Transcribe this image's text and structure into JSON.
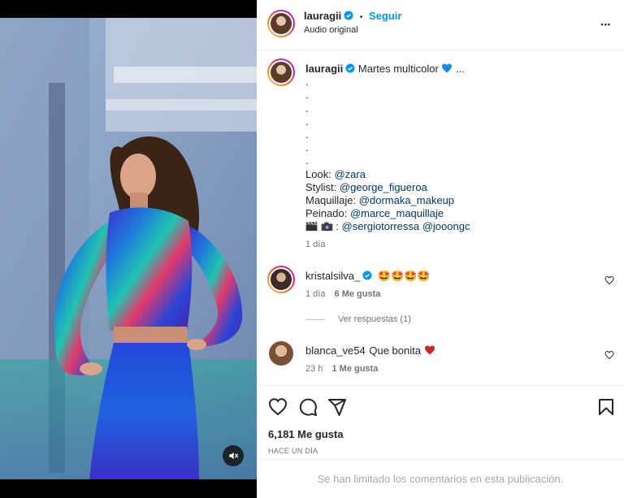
{
  "post": {
    "username": "lauragii",
    "follow_label": "Seguir",
    "separator": "•",
    "audio": "Audio original",
    "more": "•••"
  },
  "caption": {
    "username": "lauragii",
    "title": "Martes multicolor",
    "ellipsis": "...",
    "dots": [
      ".",
      ".",
      ".",
      ".",
      ".",
      ".",
      "."
    ],
    "look_label": "Look:",
    "look_mention": "@zara",
    "stylist_label": "Stylist:",
    "stylist_mention": "@george_figueroa",
    "makeup_label": "Maquillaje:",
    "makeup_mention": "@dormaka_makeup",
    "hair_label": "Peinado:",
    "hair_mention": "@marce_maquillaje",
    "camera_sep": ":",
    "camera_mention1": "@sergiotorressa",
    "camera_mention2": "@jooongc",
    "time": "1 día"
  },
  "comments": [
    {
      "username": "kristalsilva_",
      "text": "🤩🤩🤩🤩",
      "time": "1 día",
      "likes": "6 Me gusta",
      "replies": "Ver respuestas (1)"
    },
    {
      "username": "blanca_ve54",
      "text": "Que bonita",
      "time": "23 h",
      "likes": "1 Me gusta"
    }
  ],
  "footer": {
    "likes": "6,181 Me gusta",
    "date": "HACE UN DÍA",
    "limited": "Se han limitado los comentarios en esta publicación."
  },
  "colors": {
    "accent": "#0095f6",
    "mention": "#00376b",
    "muted": "#737373",
    "heart_blue": "#1e88e5",
    "heart_red": "#c62828"
  },
  "icons": [
    "verified-icon",
    "more-icon",
    "heart-icon",
    "comment-icon",
    "share-icon",
    "bookmark-icon",
    "muted-speaker-icon",
    "blue-heart-emoji",
    "red-heart-emoji",
    "star-eyes-emoji",
    "camera-emoji"
  ]
}
